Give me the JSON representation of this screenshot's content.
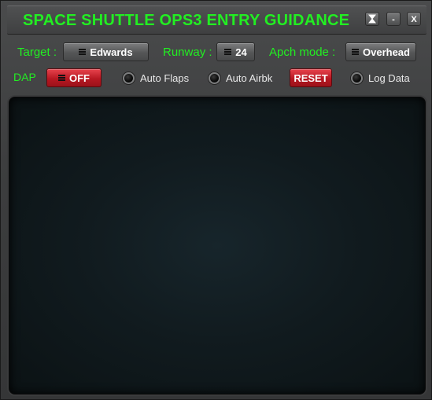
{
  "window": {
    "title": "SPACE SHUTTLE OPS3 ENTRY GUIDANCE",
    "buttons": {
      "hourglass_icon": "hourglass-icon",
      "minimize_label": "-",
      "close_label": "X"
    }
  },
  "controls": {
    "target_label": "Target :",
    "target_value": "Edwards",
    "runway_label": "Runway :",
    "runway_value": "24",
    "apch_mode_label": "Apch mode :",
    "apch_mode_value": "Overhead",
    "dap_label": "DAP",
    "dap_value": "OFF",
    "auto_flaps_label": "Auto Flaps",
    "auto_airbk_label": "Auto Airbk",
    "reset_label": "RESET",
    "log_data_label": "Log Data"
  },
  "colors": {
    "accent_green": "#22ee22",
    "button_red": "#c41d27",
    "display_bg": "#111b1f"
  }
}
